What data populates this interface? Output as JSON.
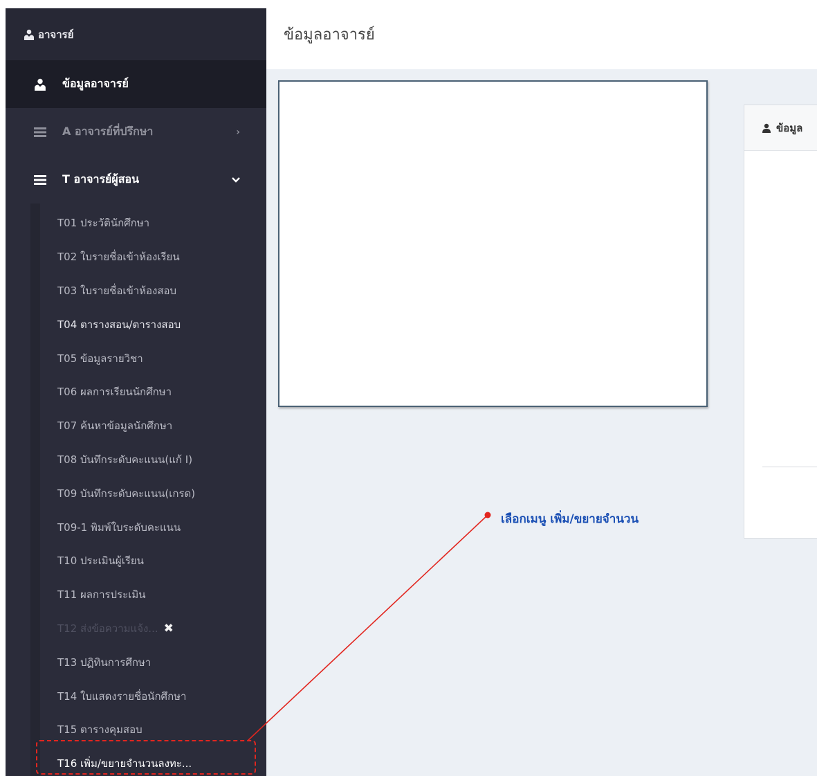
{
  "sidebar": {
    "brand": "อาจารย์",
    "menu": [
      {
        "label": "ข้อมูลอาจารย์",
        "icon": "user-tie-icon"
      },
      {
        "label": "A อาจารย์ที่ปรึกษา",
        "icon": "list-icon",
        "chevron": "right"
      },
      {
        "label": "T อาจารย์ผู้สอน",
        "icon": "list-icon",
        "chevron": "down"
      }
    ],
    "submenu": [
      "T01 ประวัตินักศึกษา",
      "T02 ใบรายชื่อเข้าห้องเรียน",
      "T03 ใบรายชื่อเข้าห้องสอบ",
      "T04 ตารางสอน/ตารางสอบ",
      "T05 ข้อมูลรายวิชา",
      "T06 ผลการเรียนนักศึกษา",
      "T07 ค้นหาข้อมูลนักศึกษา",
      "T08 บันทึกระดับคะแนน(แก้ I)",
      "T09 บันทึกระดับคะแนน(เกรด)",
      "T09-1 พิมพ์ใบระดับคะแนน",
      "T10 ประเมินผู้เรียน",
      "T11 ผลการประเมิน",
      "T12 ส่งข้อความแจ้ง...",
      "T13 ปฏิทินการศึกษา",
      "T14 ใบแสดงรายชื่อนักศึกษา",
      "T15 ตารางคุมสอบ",
      "T16 เพิ่ม/ขยายจำนวนลงทะ..."
    ]
  },
  "header": {
    "title": "ข้อมูลอาจารย์"
  },
  "info_box": {
    "title": "ข้อมูล"
  },
  "annotation": {
    "text": "เลือกเมนู เพิ่ม/ขยายจำนวน",
    "color": "#e2261f",
    "text_color": "#1a4fb4"
  }
}
